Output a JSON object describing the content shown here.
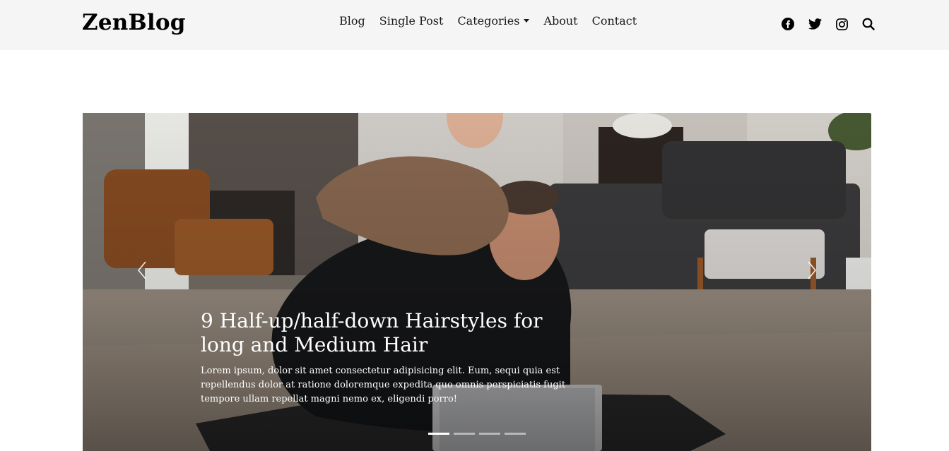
{
  "brand": {
    "logo": "ZenBlog"
  },
  "nav": {
    "items": [
      {
        "label": "Blog"
      },
      {
        "label": "Single Post"
      },
      {
        "label": "Categories",
        "has_dropdown": true
      },
      {
        "label": "About"
      },
      {
        "label": "Contact"
      }
    ]
  },
  "social": {
    "icons": [
      "facebook-icon",
      "twitter-icon",
      "instagram-icon",
      "search-icon"
    ]
  },
  "hero": {
    "title": "9 Half-up/half-down Hairstyles for long and Medium Hair",
    "excerpt": "Lorem ipsum, dolor sit amet consectetur adipisicing elit. Eum, sequi quia est repellendus dolor at ratione doloremque expedita quo omnis perspiciatis fugit tempore ullam repellat magni nemo ex, eligendi porro!",
    "slide_count": 4,
    "active_slide": 1
  },
  "colors": {
    "header_bg": "#f5f5f5",
    "text": "#000000",
    "caption_text": "#ffffff"
  }
}
